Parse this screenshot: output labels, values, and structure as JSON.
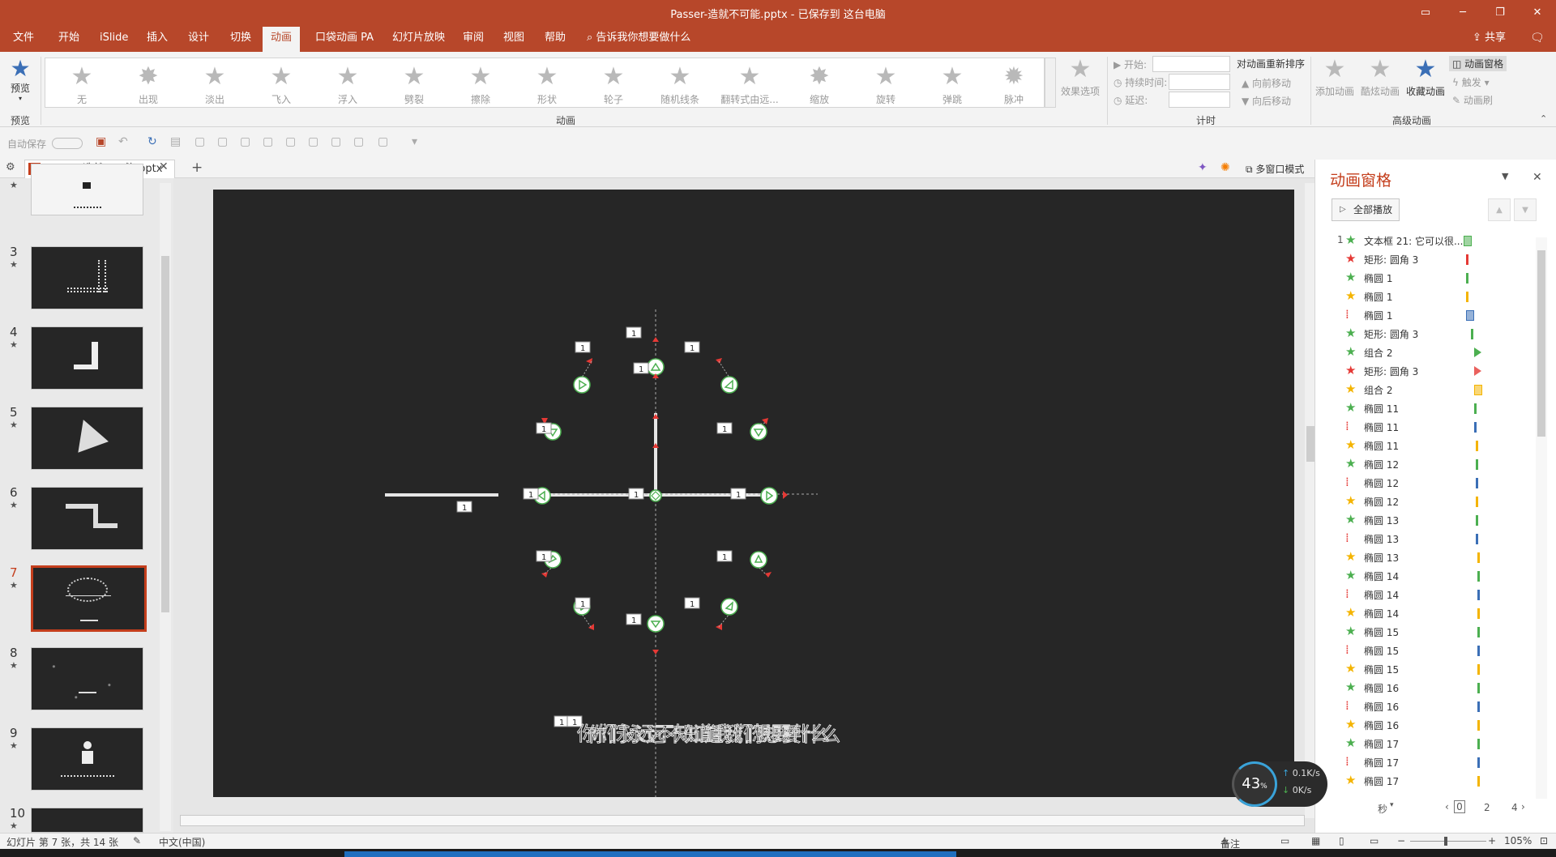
{
  "titlebar": {
    "title": "Passer-造就不可能.pptx - 已保存到 这台电脑"
  },
  "menu": {
    "tabs": [
      "文件",
      "开始",
      "iSlide",
      "插入",
      "设计",
      "切换",
      "动画",
      "口袋动画 PA",
      "幻灯片放映",
      "审阅",
      "视图",
      "帮助"
    ],
    "active": "动画",
    "search": "告诉我你想要做什么",
    "share": "共享"
  },
  "ribbon": {
    "preview_label": "预览",
    "preview_group": "预览",
    "animation_group": "动画",
    "timing_group": "计时",
    "advanced_group": "高级动画",
    "effects": [
      "无",
      "出现",
      "淡出",
      "飞入",
      "浮入",
      "劈裂",
      "擦除",
      "形状",
      "轮子",
      "随机线条",
      "翻转式由远...",
      "缩放",
      "旋转",
      "弹跳",
      "脉冲"
    ],
    "effect_options": "效果选项",
    "start_label": "开始:",
    "duration_label": "持续时间:",
    "delay_label": "延迟:",
    "reorder_title": "对动画重新排序",
    "move_earlier": "向前移动",
    "move_later": "向后移动",
    "add_animation": "添加动画",
    "cool_animation": "酷炫动画",
    "favorite_animation": "收藏动画",
    "animation_pane_btn": "动画窗格",
    "trigger": "触发",
    "animation_painter": "动画刷"
  },
  "qat": {
    "autosave": "自动保存"
  },
  "doc": {
    "tab_name": "passer-造就不可能.pptx",
    "multi_window": "多窗口模式"
  },
  "thumbs": [
    {
      "num": "",
      "star": "★"
    },
    {
      "num": "3",
      "star": "★"
    },
    {
      "num": "4",
      "star": "★"
    },
    {
      "num": "5",
      "star": "★"
    },
    {
      "num": "6",
      "star": "★"
    },
    {
      "num": "7",
      "star": "★"
    },
    {
      "num": "8",
      "star": "★"
    },
    {
      "num": "9",
      "star": "★"
    },
    {
      "num": "10",
      "star": "★"
    }
  ],
  "slide": {
    "tag": "1",
    "text_overlap": "你们永远不知道我们想要什么"
  },
  "animpane": {
    "title": "动画窗格",
    "play_all": "全部播放",
    "items": [
      {
        "num": "1",
        "icon": "star-green",
        "name": "文本框 21: 它可以很...",
        "bar": "green-box"
      },
      {
        "num": "",
        "icon": "star-red",
        "name": "矩形: 圆角 3",
        "bar": "red-thin"
      },
      {
        "num": "",
        "icon": "star-green",
        "name": "椭圆 1",
        "bar": "green-thin"
      },
      {
        "num": "",
        "icon": "star-yellow",
        "name": "椭圆 1",
        "bar": "yellow-thin"
      },
      {
        "num": "",
        "icon": "path",
        "name": "椭圆 1",
        "bar": "blue-box"
      },
      {
        "num": "",
        "icon": "star-green",
        "name": "矩形: 圆角 3",
        "bar": "green-thin"
      },
      {
        "num": "",
        "icon": "star-green",
        "name": "组合 2",
        "bar": "green-tri"
      },
      {
        "num": "",
        "icon": "star-red",
        "name": "矩形: 圆角 3",
        "bar": "red-tri"
      },
      {
        "num": "",
        "icon": "star-yellow",
        "name": "组合 2",
        "bar": "yellow-box"
      },
      {
        "num": "",
        "icon": "star-green",
        "name": "椭圆 11",
        "bar": "green-thin"
      },
      {
        "num": "",
        "icon": "path",
        "name": "椭圆 11",
        "bar": "blue-thin"
      },
      {
        "num": "",
        "icon": "star-yellow",
        "name": "椭圆 11",
        "bar": "yellow-thin"
      },
      {
        "num": "",
        "icon": "star-green",
        "name": "椭圆 12",
        "bar": "green-thin"
      },
      {
        "num": "",
        "icon": "path",
        "name": "椭圆 12",
        "bar": "blue-thin"
      },
      {
        "num": "",
        "icon": "star-yellow",
        "name": "椭圆 12",
        "bar": "yellow-thin"
      },
      {
        "num": "",
        "icon": "star-green",
        "name": "椭圆 13",
        "bar": "green-thin"
      },
      {
        "num": "",
        "icon": "path",
        "name": "椭圆 13",
        "bar": "blue-thin"
      },
      {
        "num": "",
        "icon": "star-yellow",
        "name": "椭圆 13",
        "bar": "yellow-thin"
      },
      {
        "num": "",
        "icon": "star-green",
        "name": "椭圆 14",
        "bar": "green-thin"
      },
      {
        "num": "",
        "icon": "path",
        "name": "椭圆 14",
        "bar": "blue-thin"
      },
      {
        "num": "",
        "icon": "star-yellow",
        "name": "椭圆 14",
        "bar": "yellow-thin"
      },
      {
        "num": "",
        "icon": "star-green",
        "name": "椭圆 15",
        "bar": "green-thin"
      },
      {
        "num": "",
        "icon": "path",
        "name": "椭圆 15",
        "bar": "blue-thin"
      },
      {
        "num": "",
        "icon": "star-yellow",
        "name": "椭圆 15",
        "bar": "yellow-thin"
      },
      {
        "num": "",
        "icon": "star-green",
        "name": "椭圆 16",
        "bar": "green-thin"
      },
      {
        "num": "",
        "icon": "path",
        "name": "椭圆 16",
        "bar": "blue-thin"
      },
      {
        "num": "",
        "icon": "star-yellow",
        "name": "椭圆 16",
        "bar": "yellow-thin"
      },
      {
        "num": "",
        "icon": "star-green",
        "name": "椭圆 17",
        "bar": "green-thin"
      },
      {
        "num": "",
        "icon": "path",
        "name": "椭圆 17",
        "bar": "blue-thin"
      },
      {
        "num": "",
        "icon": "star-yellow",
        "name": "椭圆 17",
        "bar": "yellow-thin"
      }
    ],
    "timeline_unit": "秒",
    "timeline_ticks": [
      "0",
      "2",
      "4"
    ]
  },
  "status": {
    "slide_info": "幻灯片 第 7 张，共 14 张",
    "language": "中文(中国)",
    "notes": "备注",
    "zoom": "105%"
  },
  "netmon": {
    "percent": "43",
    "unit": "%",
    "up": "0.1K/s",
    "down": "0K/s"
  },
  "colors": {
    "accent": "#b7472a",
    "pane_title": "#c43e1c",
    "green": "#4caf50",
    "red": "#e53935",
    "yellow": "#f4b400",
    "blue": "#3b6fb6"
  }
}
